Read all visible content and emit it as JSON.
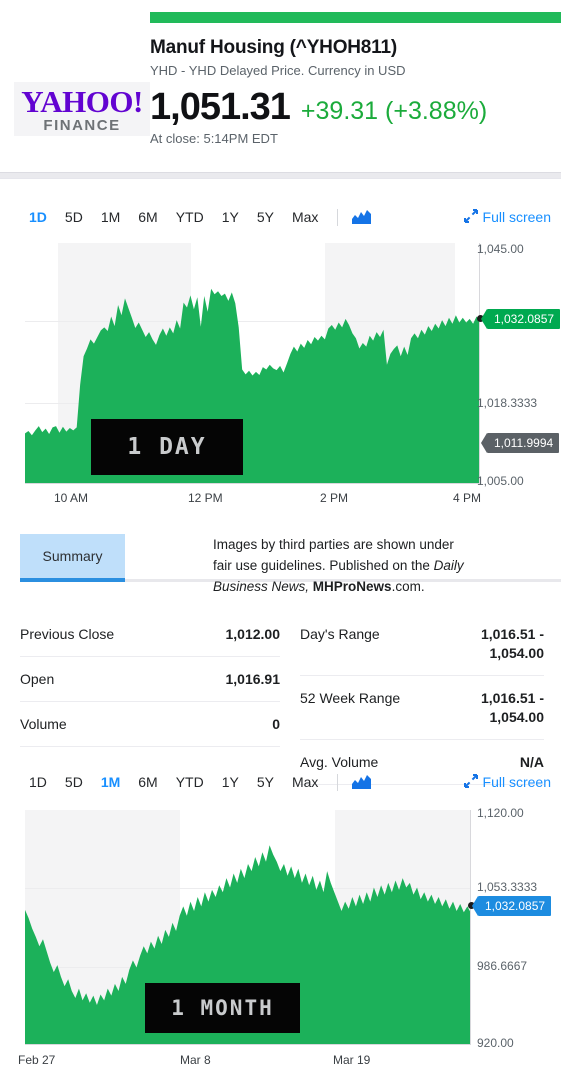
{
  "brand": {
    "name": "YAHOO!",
    "product": "FINANCE",
    "accent_green": "#21ba5a",
    "accent_purple": "#6203d1"
  },
  "header": {
    "title": "Manuf Housing (^YHOH811)",
    "subtitle": "YHD - YHD Delayed Price. Currency in USD",
    "price": "1,051.31",
    "change": "+39.31 (+3.88%)",
    "change_color": "#1bab3b",
    "market_status": "At close: 5:14PM EDT"
  },
  "range_selector_1": {
    "items": [
      "1D",
      "5D",
      "1M",
      "6M",
      "YTD",
      "1Y",
      "5Y",
      "Max"
    ],
    "active": "1D",
    "chart_type_icon": "area-chart-icon",
    "fullscreen_label": "Full screen",
    "fullscreen_icon": "expand-arrows-icon"
  },
  "range_selector_2": {
    "items": [
      "1D",
      "5D",
      "1M",
      "6M",
      "YTD",
      "1Y",
      "5Y",
      "Max"
    ],
    "active": "1M",
    "chart_type_icon": "area-chart-icon",
    "fullscreen_label": "Full screen",
    "fullscreen_icon": "expand-arrows-icon"
  },
  "tabs": {
    "summary_label": "Summary",
    "active": "Summary"
  },
  "fair_use_note": {
    "line1": "Images by third parties are shown under",
    "line2a": "fair use guidelines.  Published on the ",
    "line2b": "Daily",
    "line3a": "Business News,",
    "line3b": " MHProNews",
    "line3c": ".com."
  },
  "stats": {
    "left": [
      {
        "label": "Previous Close",
        "value": "1,012.00"
      },
      {
        "label": "Open",
        "value": "1,016.91"
      },
      {
        "label": "Volume",
        "value": "0"
      }
    ],
    "right": [
      {
        "label": "Day's Range",
        "value": "1,016.51 -\n1,054.00"
      },
      {
        "label": "52 Week Range",
        "value": "1,016.51 -\n1,054.00"
      },
      {
        "label": "Avg. Volume",
        "value": "N/A"
      }
    ]
  },
  "chart_data": [
    {
      "type": "area",
      "title": "1 DAY",
      "watermark": "1 DAY",
      "xlabel": "",
      "ylabel": "",
      "x_ticks": [
        "10 AM",
        "12 PM",
        "2 PM",
        "4 PM"
      ],
      "y_ticks": [
        "1,045.00",
        "1,018.3333",
        "1,005.00"
      ],
      "ylim": [
        1005.0,
        1045.0
      ],
      "grid": true,
      "series_color": "#1cb15a",
      "last_value_badge": {
        "text": "1,032.0857",
        "color": "#00a950"
      },
      "prev_close_badge": {
        "text": "1,011.9994",
        "color": "#5b6166"
      },
      "values": [
        1013.4,
        1013.8,
        1013.1,
        1013.9,
        1014.6,
        1013.6,
        1014.2,
        1013.3,
        1014.4,
        1014.6,
        1013.5,
        1014.5,
        1013.7,
        1014.3,
        1013.9,
        1014.4,
        1021.5,
        1026.2,
        1027.5,
        1029.0,
        1028.3,
        1029.4,
        1030.5,
        1031.0,
        1030.4,
        1032.8,
        1031.2,
        1034.7,
        1033.0,
        1035.8,
        1034.2,
        1032.6,
        1030.9,
        1031.8,
        1030.6,
        1029.4,
        1030.2,
        1029.0,
        1028.1,
        1029.7,
        1030.8,
        1029.6,
        1031.0,
        1030.0,
        1032.2,
        1030.8,
        1035.1,
        1034.3,
        1036.3,
        1034.0,
        1036.0,
        1031.1,
        1036.2,
        1033.6,
        1037.4,
        1036.5,
        1037.0,
        1036.2,
        1036.6,
        1035.4,
        1036.8,
        1035.0,
        1031.0,
        1024.0,
        1023.2,
        1023.8,
        1023.0,
        1023.6,
        1023.1,
        1024.4,
        1024.0,
        1024.8,
        1024.2,
        1023.9,
        1024.6,
        1023.5,
        1025.0,
        1026.6,
        1027.8,
        1027.0,
        1028.3,
        1027.6,
        1028.9,
        1028.2,
        1029.4,
        1028.8,
        1029.6,
        1029.0,
        1030.8,
        1031.4,
        1030.6,
        1031.8,
        1031.0,
        1032.4,
        1031.4,
        1030.0,
        1029.2,
        1027.5,
        1028.4,
        1027.8,
        1029.6,
        1028.8,
        1030.2,
        1029.4,
        1030.6,
        1024.8,
        1026.6,
        1027.4,
        1028.0,
        1026.2,
        1027.8,
        1026.4,
        1029.2,
        1030.0,
        1029.2,
        1030.6,
        1029.8,
        1031.2,
        1030.4,
        1031.6,
        1030.8,
        1032.2,
        1031.2,
        1032.6,
        1031.6,
        1033.0,
        1031.8,
        1032.6,
        1031.8,
        1032.4,
        1031.6,
        1032.8,
        1032.0857
      ]
    },
    {
      "type": "area",
      "title": "1 MONTH",
      "watermark": "1 MONTH",
      "xlabel": "",
      "ylabel": "",
      "x_ticks": [
        "Feb 27",
        "Mar 8",
        "Mar 19"
      ],
      "y_ticks": [
        "1,120.00",
        "1,053.3333",
        "986.6667",
        "920.00"
      ],
      "ylim": [
        920.0,
        1120.0
      ],
      "grid": true,
      "series_color": "#1cb15a",
      "last_value_badge": {
        "text": "1,032.0857",
        "color": "#1d8ce0"
      },
      "values": [
        1035.0,
        1028.0,
        1019.0,
        1012.0,
        1004.0,
        1010.0,
        1000.0,
        990.0,
        982.0,
        988.0,
        978.0,
        970.0,
        976.0,
        966.0,
        960.0,
        968.0,
        958.0,
        964.0,
        956.0,
        962.0,
        954.0,
        963.0,
        958.0,
        968.0,
        962.0,
        972.0,
        966.0,
        978.0,
        972.0,
        984.0,
        992.0,
        986.0,
        996.0,
        1004.0,
        998.0,
        1008.0,
        1002.0,
        1013.0,
        1006.0,
        1018.0,
        1012.0,
        1024.0,
        1017.0,
        1030.0,
        1038.0,
        1030.0,
        1042.0,
        1034.0,
        1046.0,
        1038.0,
        1050.0,
        1042.0,
        1052.0,
        1046.0,
        1056.0,
        1050.0,
        1062.0,
        1054.0,
        1066.0,
        1058.0,
        1070.0,
        1062.0,
        1074.0,
        1068.0,
        1080.0,
        1072.0,
        1084.0,
        1076.0,
        1090.0,
        1082.0,
        1076.0,
        1068.0,
        1074.0,
        1064.0,
        1072.0,
        1062.0,
        1070.0,
        1058.0,
        1066.0,
        1056.0,
        1064.0,
        1052.0,
        1060.0,
        1050.0,
        1068.0,
        1058.0,
        1050.0,
        1042.0,
        1034.0,
        1042.0,
        1036.0,
        1046.0,
        1038.0,
        1048.0,
        1040.0,
        1050.0,
        1042.0,
        1054.0,
        1046.0,
        1056.0,
        1048.0,
        1058.0,
        1050.0,
        1060.0,
        1052.0,
        1062.0,
        1054.0,
        1058.0,
        1048.0,
        1054.0,
        1044.0,
        1050.0,
        1042.0,
        1048.0,
        1040.0,
        1046.0,
        1038.0,
        1044.0,
        1036.0,
        1042.0,
        1034.0,
        1040.0,
        1033.0,
        1038.0,
        1032.0857
      ]
    }
  ]
}
